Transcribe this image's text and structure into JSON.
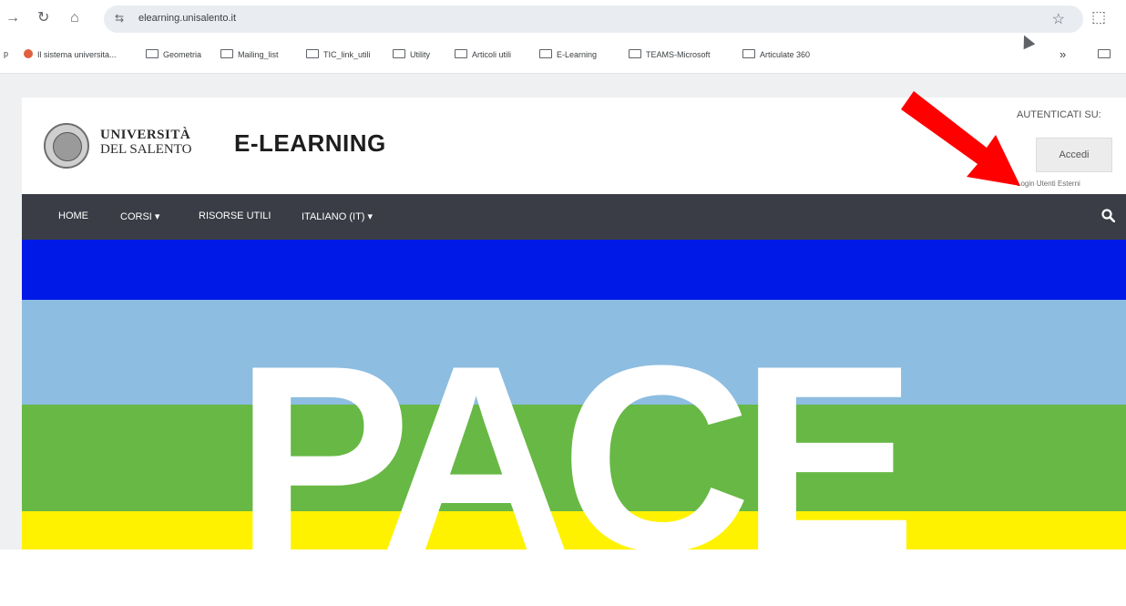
{
  "browser": {
    "url": "elearning.unisalento.it",
    "bookmarks": [
      "Il sistema universita...",
      "Geometria",
      "Mailing_list",
      "TIC_link_utili",
      "Utility",
      "Articoli utili",
      "E-Learning",
      "TEAMS-Microsoft",
      "Articulate 360"
    ],
    "more_label": "»"
  },
  "header": {
    "logo_line1": "UNIVERSITÀ",
    "logo_line2": "DEL SALENTO",
    "title": "E-LEARNING",
    "auth_label": "AUTENTICATI SU:",
    "login_button": "Accedi",
    "external_login": "Login Utenti Esterni"
  },
  "nav": {
    "items": [
      "HOME",
      "CORSI ▾",
      "RISORSE UTILI",
      "ITALIANO (IT) ▾"
    ]
  },
  "banner": {
    "text": "PACE",
    "stripes": [
      "#0019e6",
      "#8dbde0",
      "#67b845",
      "#fff200"
    ]
  },
  "colors": {
    "navbar": "#3a3d46",
    "arrow": "#ff0000"
  }
}
